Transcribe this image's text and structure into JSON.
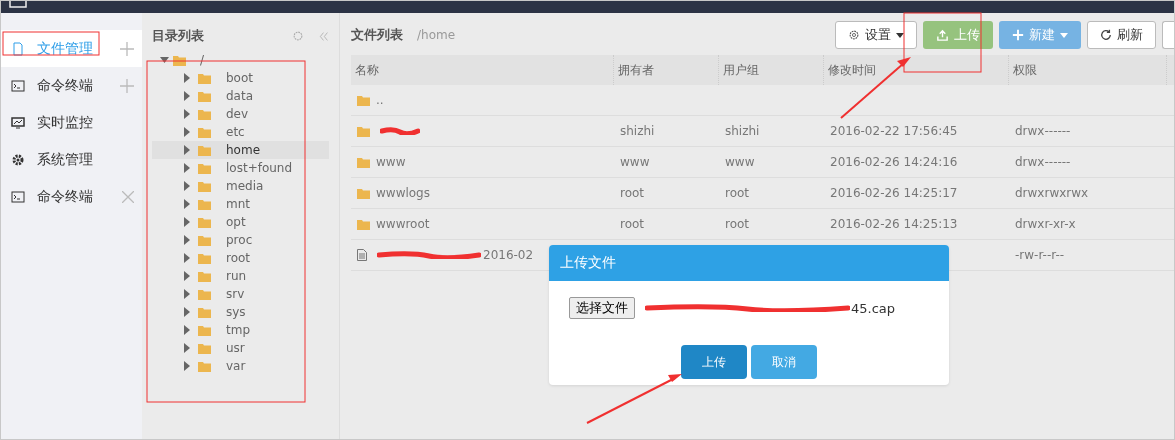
{
  "sidebar": {
    "items": [
      {
        "label": "文件管理",
        "kind": "file",
        "addable": true,
        "closable": false,
        "selected": true
      },
      {
        "label": "命令终端",
        "kind": "terminal",
        "addable": true,
        "closable": false,
        "selected": false
      },
      {
        "label": "实时监控",
        "kind": "monitor",
        "addable": false,
        "closable": false,
        "selected": false
      },
      {
        "label": "系统管理",
        "kind": "gear",
        "addable": false,
        "closable": false,
        "selected": false
      },
      {
        "label": "命令终端",
        "kind": "terminal",
        "addable": false,
        "closable": true,
        "selected": false
      }
    ]
  },
  "directory": {
    "title": "目录列表",
    "tree": {
      "label": "/",
      "expanded": true,
      "children": [
        {
          "label": "boot",
          "expanded": false,
          "selected": false
        },
        {
          "label": "data",
          "expanded": false,
          "selected": false
        },
        {
          "label": "dev",
          "expanded": false,
          "selected": false
        },
        {
          "label": "etc",
          "expanded": false,
          "selected": false
        },
        {
          "label": "home",
          "expanded": false,
          "selected": true
        },
        {
          "label": "lost+found",
          "expanded": false,
          "selected": false
        },
        {
          "label": "media",
          "expanded": false,
          "selected": false
        },
        {
          "label": "mnt",
          "expanded": false,
          "selected": false
        },
        {
          "label": "opt",
          "expanded": false,
          "selected": false
        },
        {
          "label": "proc",
          "expanded": false,
          "selected": false
        },
        {
          "label": "root",
          "expanded": false,
          "selected": false
        },
        {
          "label": "run",
          "expanded": false,
          "selected": false
        },
        {
          "label": "srv",
          "expanded": false,
          "selected": false
        },
        {
          "label": "sys",
          "expanded": false,
          "selected": false
        },
        {
          "label": "tmp",
          "expanded": false,
          "selected": false
        },
        {
          "label": "usr",
          "expanded": false,
          "selected": false
        },
        {
          "label": "var",
          "expanded": false,
          "selected": false
        }
      ]
    }
  },
  "file_list": {
    "title": "文件列表",
    "path": "/home",
    "toolbar": [
      {
        "label": "设置",
        "kind": "settings",
        "dropdown": true
      },
      {
        "label": "上传",
        "kind": "upload",
        "dropdown": false
      },
      {
        "label": "新建",
        "kind": "new",
        "dropdown": true
      },
      {
        "label": "刷新",
        "kind": "refresh",
        "dropdown": false
      }
    ],
    "columns": [
      "名称",
      "拥有者",
      "用户组",
      "修改时间",
      "权限"
    ],
    "rows": [
      {
        "kind": "folder",
        "redacted": false,
        "name": ".."
      },
      {
        "kind": "folder",
        "redacted": true,
        "owner": "shizhi",
        "group": "shizhi",
        "modified": "2016-02-22 17:56:45",
        "permissions": "drwx------"
      },
      {
        "kind": "folder",
        "redacted": false,
        "name": "www",
        "owner": "www",
        "group": "www",
        "modified": "2016-02-26 14:24:16",
        "permissions": "drwx------"
      },
      {
        "kind": "folder",
        "redacted": false,
        "name": "wwwlogs",
        "owner": "root",
        "group": "root",
        "modified": "2016-02-26 14:25:17",
        "permissions": "drwxrwxrwx"
      },
      {
        "kind": "folder",
        "redacted": false,
        "name": "wwwroot",
        "owner": "root",
        "group": "root",
        "modified": "2016-02-26 14:25:13",
        "permissions": "drwxr-xr-x"
      },
      {
        "kind": "file",
        "redacted": true,
        "name": "2016-02",
        "permissions": "-rw-r--r--"
      }
    ]
  },
  "dialog": {
    "title": "上传文件",
    "file_button": "选择文件",
    "file_name": "45.cap",
    "buttons": [
      {
        "label": "上传",
        "kind": "primary"
      },
      {
        "label": "取消",
        "kind": "secondary"
      }
    ]
  }
}
